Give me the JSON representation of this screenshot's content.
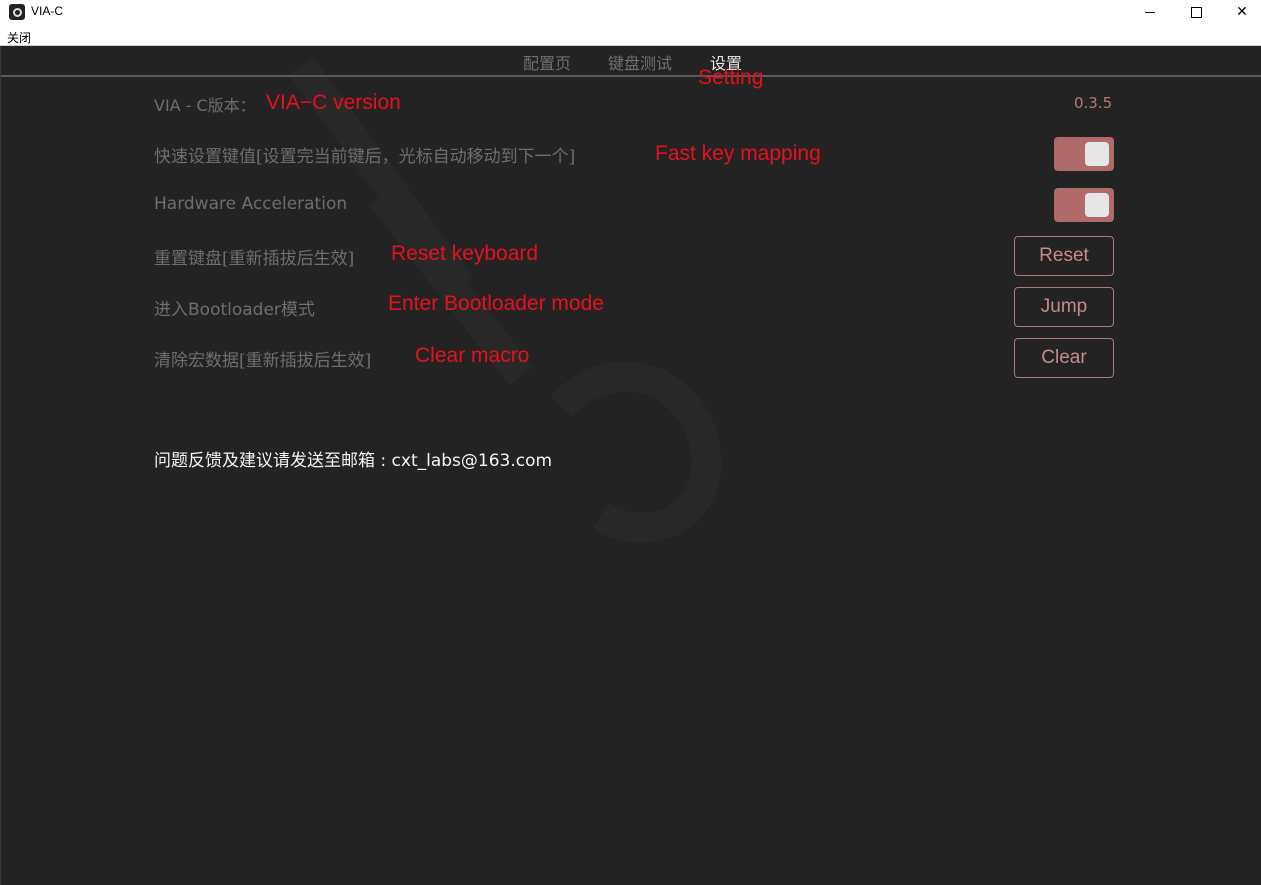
{
  "window": {
    "title": "VIA-C",
    "minimize_icon": "minimize-icon",
    "maximize_icon": "maximize-icon",
    "close_glyph": "✕"
  },
  "menubar": {
    "item": "关闭"
  },
  "tabs": [
    {
      "label": "配置页"
    },
    {
      "label": "键盘测试"
    },
    {
      "label": "设置"
    }
  ],
  "annotations": {
    "setting": "Setting",
    "version": "VIA−C  version",
    "fast_key": "Fast  key  mapping",
    "reset": "Reset  keyboard",
    "bootloader": "Enter  Bootloader  mode",
    "macro": "Clear  macro"
  },
  "settings": {
    "version": {
      "label": "VIA - C版本：",
      "value": "0.3.5"
    },
    "fast_key": {
      "label": "快速设置键值[设置完当前键后，光标自动移动到下一个]",
      "enabled": true
    },
    "hw_accel": {
      "label": "Hardware Acceleration",
      "enabled": true
    },
    "reset": {
      "label": "重置键盘[重新插拔后生效]",
      "button": "Reset"
    },
    "bootloader": {
      "label": "进入Bootloader模式",
      "button": "Jump"
    },
    "clear_macro": {
      "label": "清除宏数据[重新插拔后生效]",
      "button": "Clear"
    }
  },
  "feedback": "问题反馈及建议请发送至邮箱 : cxt_labs@163.com",
  "colors": {
    "background": "#232323",
    "accent": "#b06a6a",
    "annotation": "#e8101e"
  }
}
